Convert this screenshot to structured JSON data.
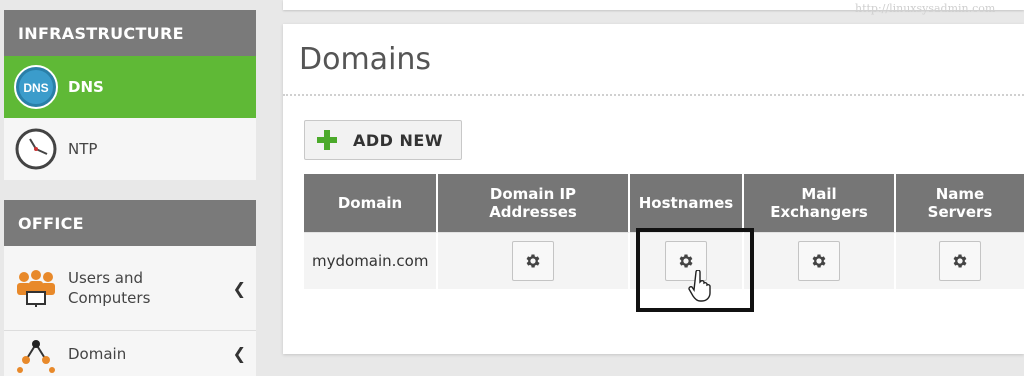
{
  "sidebar": {
    "infrastructure_heading": "INFRASTRUCTURE",
    "infrastructure_items": [
      {
        "label": "DNS",
        "icon": "dns-globe-icon",
        "active": true
      },
      {
        "label": "NTP",
        "icon": "clock-icon",
        "active": false
      }
    ],
    "office_heading": "OFFICE",
    "office_items": [
      {
        "label_line1": "Users and",
        "label_line2": "Computers",
        "icon": "users-icon"
      },
      {
        "label": "Domain",
        "icon": "domain-tree-icon"
      }
    ],
    "dns_badge": "DNS"
  },
  "main": {
    "title": "Domains",
    "add_button_label": "ADD NEW",
    "watermark": "http://linuxsysadmin.com",
    "table": {
      "headers": [
        {
          "line1": "Domain",
          "line2": ""
        },
        {
          "line1": "Domain IP",
          "line2": "Addresses"
        },
        {
          "line1": "Hostnames",
          "line2": ""
        },
        {
          "line1": "Mail",
          "line2": "Exchangers"
        },
        {
          "line1": "Name",
          "line2": "Servers"
        }
      ],
      "rows": [
        {
          "domain": "mydomain.com"
        }
      ]
    }
  },
  "colors": {
    "active_green": "#5fb936",
    "header_gray": "#767676",
    "add_icon_green": "#4caa2b"
  }
}
